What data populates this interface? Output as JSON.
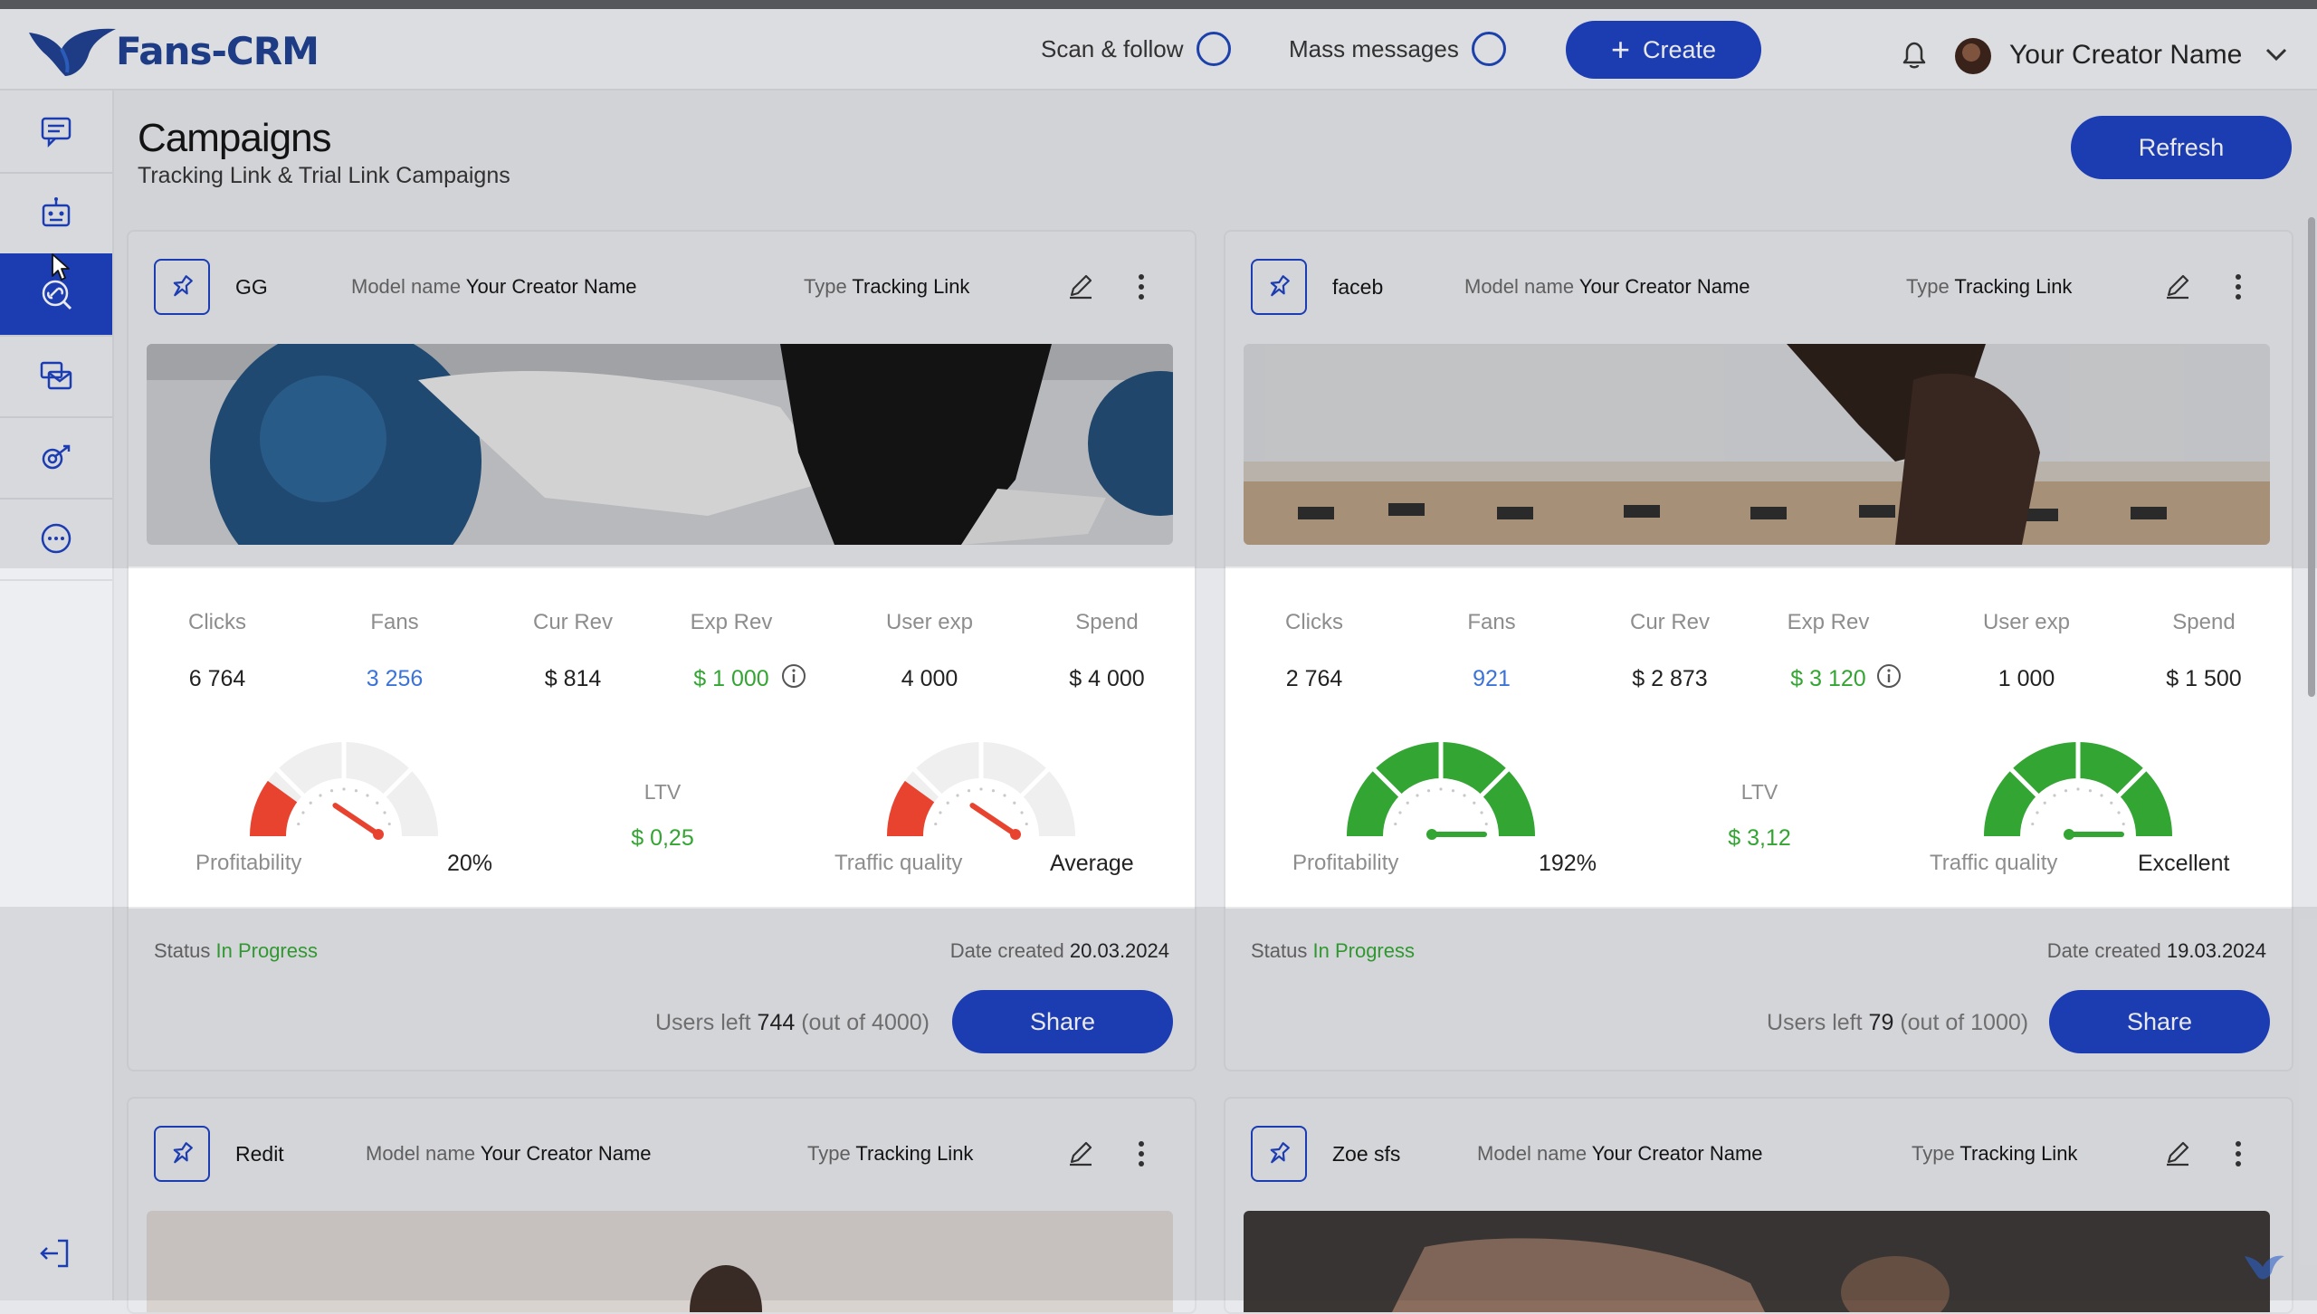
{
  "app": {
    "logo_text": "Fans-CRM"
  },
  "topbar": {
    "scan_follow": "Scan & follow",
    "mass_messages": "Mass messages",
    "create_label": "Create",
    "user_name": "Your Creator Name"
  },
  "header": {
    "title": "Campaigns",
    "subtitle": "Tracking Link & Trial Link Campaigns",
    "refresh_label": "Refresh"
  },
  "labels": {
    "model_name": "Model name",
    "type": "Type",
    "clicks": "Clicks",
    "fans": "Fans",
    "cur_rev": "Cur Rev",
    "exp_rev": "Exp Rev",
    "user_exp": "User exp",
    "spend": "Spend",
    "ltv": "LTV",
    "profitability": "Profitability",
    "traffic_quality": "Traffic quality",
    "status": "Status",
    "date_created": "Date created",
    "users_left": "Users left",
    "share": "Share"
  },
  "colors": {
    "accent": "#1b3fc0",
    "positive": "#33a532",
    "negative": "#e8432f",
    "link": "#3b73d9"
  },
  "campaigns": [
    {
      "name": "GG",
      "model_name": "Your Creator Name",
      "type": "Tracking Link",
      "clicks": "6 764",
      "fans": "3 256",
      "cur_rev": "$ 814",
      "exp_rev": "$ 1 000",
      "user_exp": "4 000",
      "spend": "$ 4 000",
      "ltv": "$ 0,25",
      "profitability": "20%",
      "profitability_level": 0.2,
      "traffic_quality": "Average",
      "traffic_level": 0.2,
      "status": "In Progress",
      "date_created": "20.03.2024",
      "users_left": "744",
      "out_of": "(out of 4000)"
    },
    {
      "name": "faceb",
      "model_name": "Your Creator Name",
      "type": "Tracking Link",
      "clicks": "2 764",
      "fans": "921",
      "cur_rev": "$ 2 873",
      "exp_rev": "$ 3 120",
      "user_exp": "1 000",
      "spend": "$ 1 500",
      "ltv": "$ 3,12",
      "profitability": "192%",
      "profitability_level": 1.0,
      "traffic_quality": "Excellent",
      "traffic_level": 1.0,
      "status": "In Progress",
      "date_created": "19.03.2024",
      "users_left": "79",
      "out_of": "(out of 1000)"
    },
    {
      "name": "Redit",
      "model_name": "Your Creator Name",
      "type": "Tracking Link"
    },
    {
      "name": "Zoe sfs",
      "model_name": "Your Creator Name",
      "type": "Tracking Link"
    }
  ],
  "icons": {
    "sidebar": [
      "chat-icon",
      "bot-icon",
      "campaign-link-icon",
      "mass-message-icon",
      "tracking-icon",
      "more-icon"
    ],
    "logout": "logout-icon"
  }
}
